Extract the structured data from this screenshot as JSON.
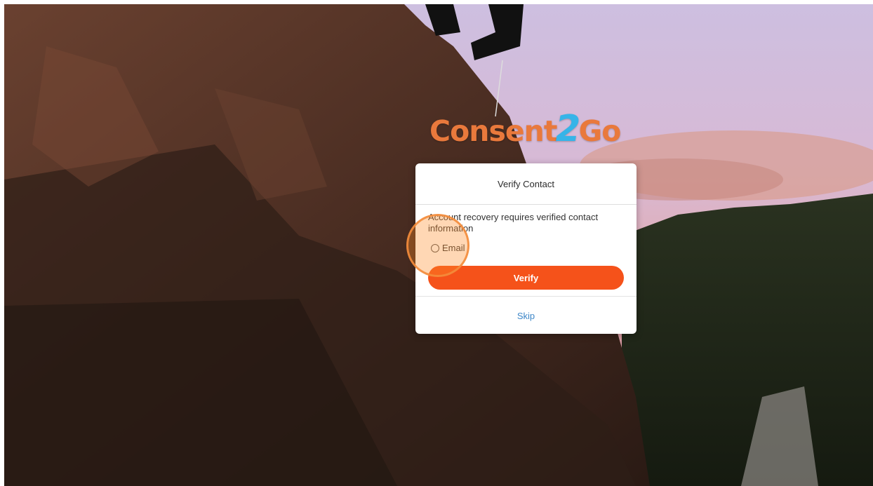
{
  "brand": {
    "logo_part1": "Consent",
    "logo_part2": "2",
    "logo_part3": "Go"
  },
  "dialog": {
    "title": "Verify Contact",
    "message": "Account recovery requires verified contact information",
    "radio_label": "Email",
    "verify_label": "Verify",
    "skip_label": "Skip"
  },
  "colors": {
    "accent": "#f5521a",
    "link": "#3e87c8",
    "logo_orange": "#e9793c",
    "logo_blue": "#36b4e8",
    "highlight": "#f38d3c"
  }
}
